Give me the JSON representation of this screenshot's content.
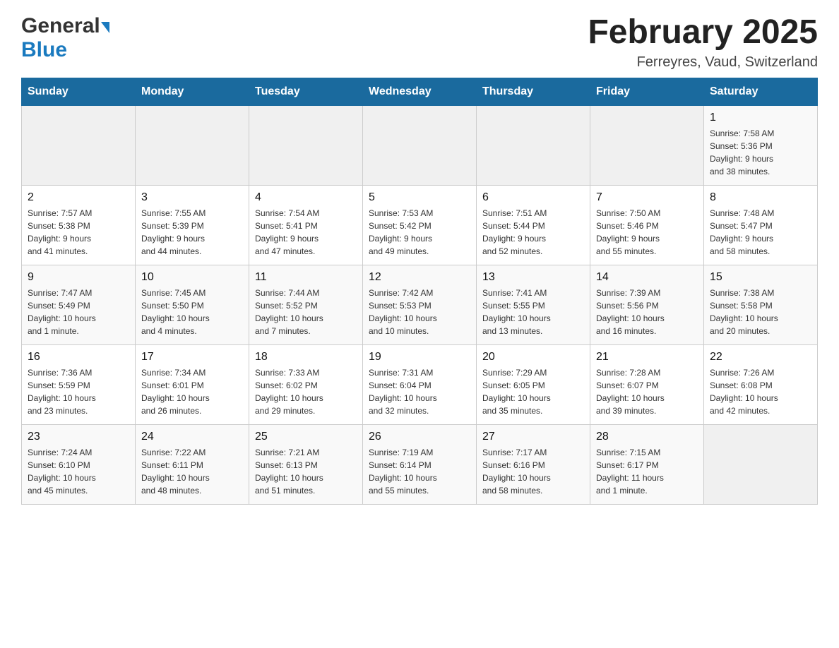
{
  "header": {
    "logo_general": "General",
    "logo_blue": "Blue",
    "month_title": "February 2025",
    "location": "Ferreyres, Vaud, Switzerland"
  },
  "weekdays": [
    "Sunday",
    "Monday",
    "Tuesday",
    "Wednesday",
    "Thursday",
    "Friday",
    "Saturday"
  ],
  "weeks": [
    [
      {
        "day": "",
        "info": ""
      },
      {
        "day": "",
        "info": ""
      },
      {
        "day": "",
        "info": ""
      },
      {
        "day": "",
        "info": ""
      },
      {
        "day": "",
        "info": ""
      },
      {
        "day": "",
        "info": ""
      },
      {
        "day": "1",
        "info": "Sunrise: 7:58 AM\nSunset: 5:36 PM\nDaylight: 9 hours\nand 38 minutes."
      }
    ],
    [
      {
        "day": "2",
        "info": "Sunrise: 7:57 AM\nSunset: 5:38 PM\nDaylight: 9 hours\nand 41 minutes."
      },
      {
        "day": "3",
        "info": "Sunrise: 7:55 AM\nSunset: 5:39 PM\nDaylight: 9 hours\nand 44 minutes."
      },
      {
        "day": "4",
        "info": "Sunrise: 7:54 AM\nSunset: 5:41 PM\nDaylight: 9 hours\nand 47 minutes."
      },
      {
        "day": "5",
        "info": "Sunrise: 7:53 AM\nSunset: 5:42 PM\nDaylight: 9 hours\nand 49 minutes."
      },
      {
        "day": "6",
        "info": "Sunrise: 7:51 AM\nSunset: 5:44 PM\nDaylight: 9 hours\nand 52 minutes."
      },
      {
        "day": "7",
        "info": "Sunrise: 7:50 AM\nSunset: 5:46 PM\nDaylight: 9 hours\nand 55 minutes."
      },
      {
        "day": "8",
        "info": "Sunrise: 7:48 AM\nSunset: 5:47 PM\nDaylight: 9 hours\nand 58 minutes."
      }
    ],
    [
      {
        "day": "9",
        "info": "Sunrise: 7:47 AM\nSunset: 5:49 PM\nDaylight: 10 hours\nand 1 minute."
      },
      {
        "day": "10",
        "info": "Sunrise: 7:45 AM\nSunset: 5:50 PM\nDaylight: 10 hours\nand 4 minutes."
      },
      {
        "day": "11",
        "info": "Sunrise: 7:44 AM\nSunset: 5:52 PM\nDaylight: 10 hours\nand 7 minutes."
      },
      {
        "day": "12",
        "info": "Sunrise: 7:42 AM\nSunset: 5:53 PM\nDaylight: 10 hours\nand 10 minutes."
      },
      {
        "day": "13",
        "info": "Sunrise: 7:41 AM\nSunset: 5:55 PM\nDaylight: 10 hours\nand 13 minutes."
      },
      {
        "day": "14",
        "info": "Sunrise: 7:39 AM\nSunset: 5:56 PM\nDaylight: 10 hours\nand 16 minutes."
      },
      {
        "day": "15",
        "info": "Sunrise: 7:38 AM\nSunset: 5:58 PM\nDaylight: 10 hours\nand 20 minutes."
      }
    ],
    [
      {
        "day": "16",
        "info": "Sunrise: 7:36 AM\nSunset: 5:59 PM\nDaylight: 10 hours\nand 23 minutes."
      },
      {
        "day": "17",
        "info": "Sunrise: 7:34 AM\nSunset: 6:01 PM\nDaylight: 10 hours\nand 26 minutes."
      },
      {
        "day": "18",
        "info": "Sunrise: 7:33 AM\nSunset: 6:02 PM\nDaylight: 10 hours\nand 29 minutes."
      },
      {
        "day": "19",
        "info": "Sunrise: 7:31 AM\nSunset: 6:04 PM\nDaylight: 10 hours\nand 32 minutes."
      },
      {
        "day": "20",
        "info": "Sunrise: 7:29 AM\nSunset: 6:05 PM\nDaylight: 10 hours\nand 35 minutes."
      },
      {
        "day": "21",
        "info": "Sunrise: 7:28 AM\nSunset: 6:07 PM\nDaylight: 10 hours\nand 39 minutes."
      },
      {
        "day": "22",
        "info": "Sunrise: 7:26 AM\nSunset: 6:08 PM\nDaylight: 10 hours\nand 42 minutes."
      }
    ],
    [
      {
        "day": "23",
        "info": "Sunrise: 7:24 AM\nSunset: 6:10 PM\nDaylight: 10 hours\nand 45 minutes."
      },
      {
        "day": "24",
        "info": "Sunrise: 7:22 AM\nSunset: 6:11 PM\nDaylight: 10 hours\nand 48 minutes."
      },
      {
        "day": "25",
        "info": "Sunrise: 7:21 AM\nSunset: 6:13 PM\nDaylight: 10 hours\nand 51 minutes."
      },
      {
        "day": "26",
        "info": "Sunrise: 7:19 AM\nSunset: 6:14 PM\nDaylight: 10 hours\nand 55 minutes."
      },
      {
        "day": "27",
        "info": "Sunrise: 7:17 AM\nSunset: 6:16 PM\nDaylight: 10 hours\nand 58 minutes."
      },
      {
        "day": "28",
        "info": "Sunrise: 7:15 AM\nSunset: 6:17 PM\nDaylight: 11 hours\nand 1 minute."
      },
      {
        "day": "",
        "info": ""
      }
    ]
  ]
}
